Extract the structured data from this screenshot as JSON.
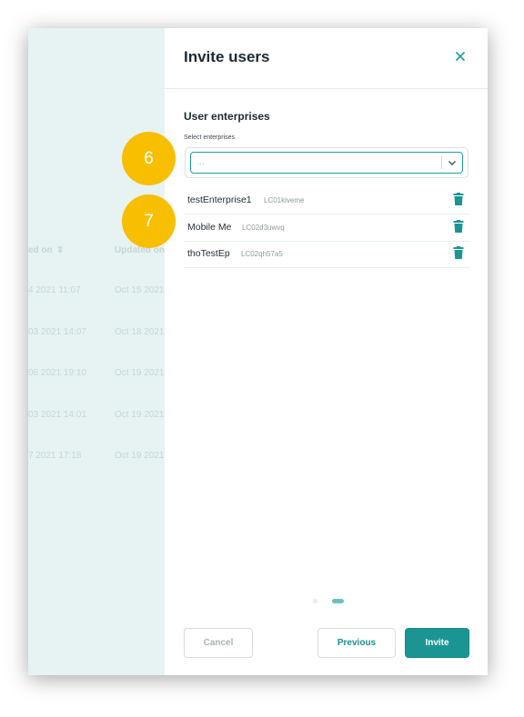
{
  "background_table": {
    "headers": [
      "ed on",
      "Updated on"
    ],
    "rows": [
      [
        "4 2021 11:07",
        "Oct 15 2021"
      ],
      [
        "03 2021 14:07",
        "Oct 18 2021"
      ],
      [
        "06 2021 19:10",
        "Oct 19 2021"
      ],
      [
        "03 2021 14:01",
        "Oct 19 2021"
      ],
      [
        "7 2021 17:18",
        "Oct 19 2021"
      ]
    ]
  },
  "dialog": {
    "title": "Invite users",
    "close_icon": "close-icon",
    "section_title": "User enterprises",
    "select_label": "Select enterprises",
    "select_placeholder": "...",
    "enterprises": [
      {
        "name": "testEnterprise1",
        "code": "LC01kiveme"
      },
      {
        "name": "Mobile Me",
        "code": "LC02d3uwvq"
      },
      {
        "name": "thoTestEp",
        "code": "LC02qh57a5"
      }
    ],
    "step": {
      "total": 2,
      "current": 2
    },
    "buttons": {
      "cancel": "Cancel",
      "previous": "Previous",
      "invite": "Invite"
    }
  },
  "callouts": [
    "6",
    "7"
  ],
  "colors": {
    "accent": "#1a9593",
    "callout": "#f8be00",
    "background_panel": "#e7f3f3"
  }
}
